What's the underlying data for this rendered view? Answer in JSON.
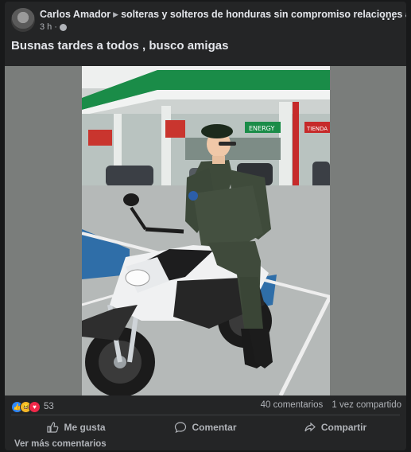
{
  "post": {
    "author": "Carlos Amador",
    "group": "solteras y solteros de honduras sin compromiso relaciones abiertas",
    "time": "3 h",
    "text": "Busnas tardes a todos , busco amigas"
  },
  "engagement": {
    "reaction_count": "53",
    "comments": "40 comentarios",
    "shares": "1 vez compartido"
  },
  "actions": {
    "like": "Me gusta",
    "comment": "Comentar",
    "share": "Compartir"
  },
  "footer": {
    "see_more": "Ver más comentarios"
  },
  "photo_signs": {
    "sign1": "ENERGY",
    "sign2": "TIENDA"
  },
  "colors": {
    "background": "#18191a",
    "card": "#242526",
    "accent": "#2d88ff"
  },
  "icons": [
    "globe-icon",
    "more-options-icon",
    "like-reaction-icon",
    "haha-reaction-icon",
    "love-reaction-icon",
    "thumbs-up-icon",
    "comment-bubble-icon",
    "share-arrow-icon"
  ]
}
